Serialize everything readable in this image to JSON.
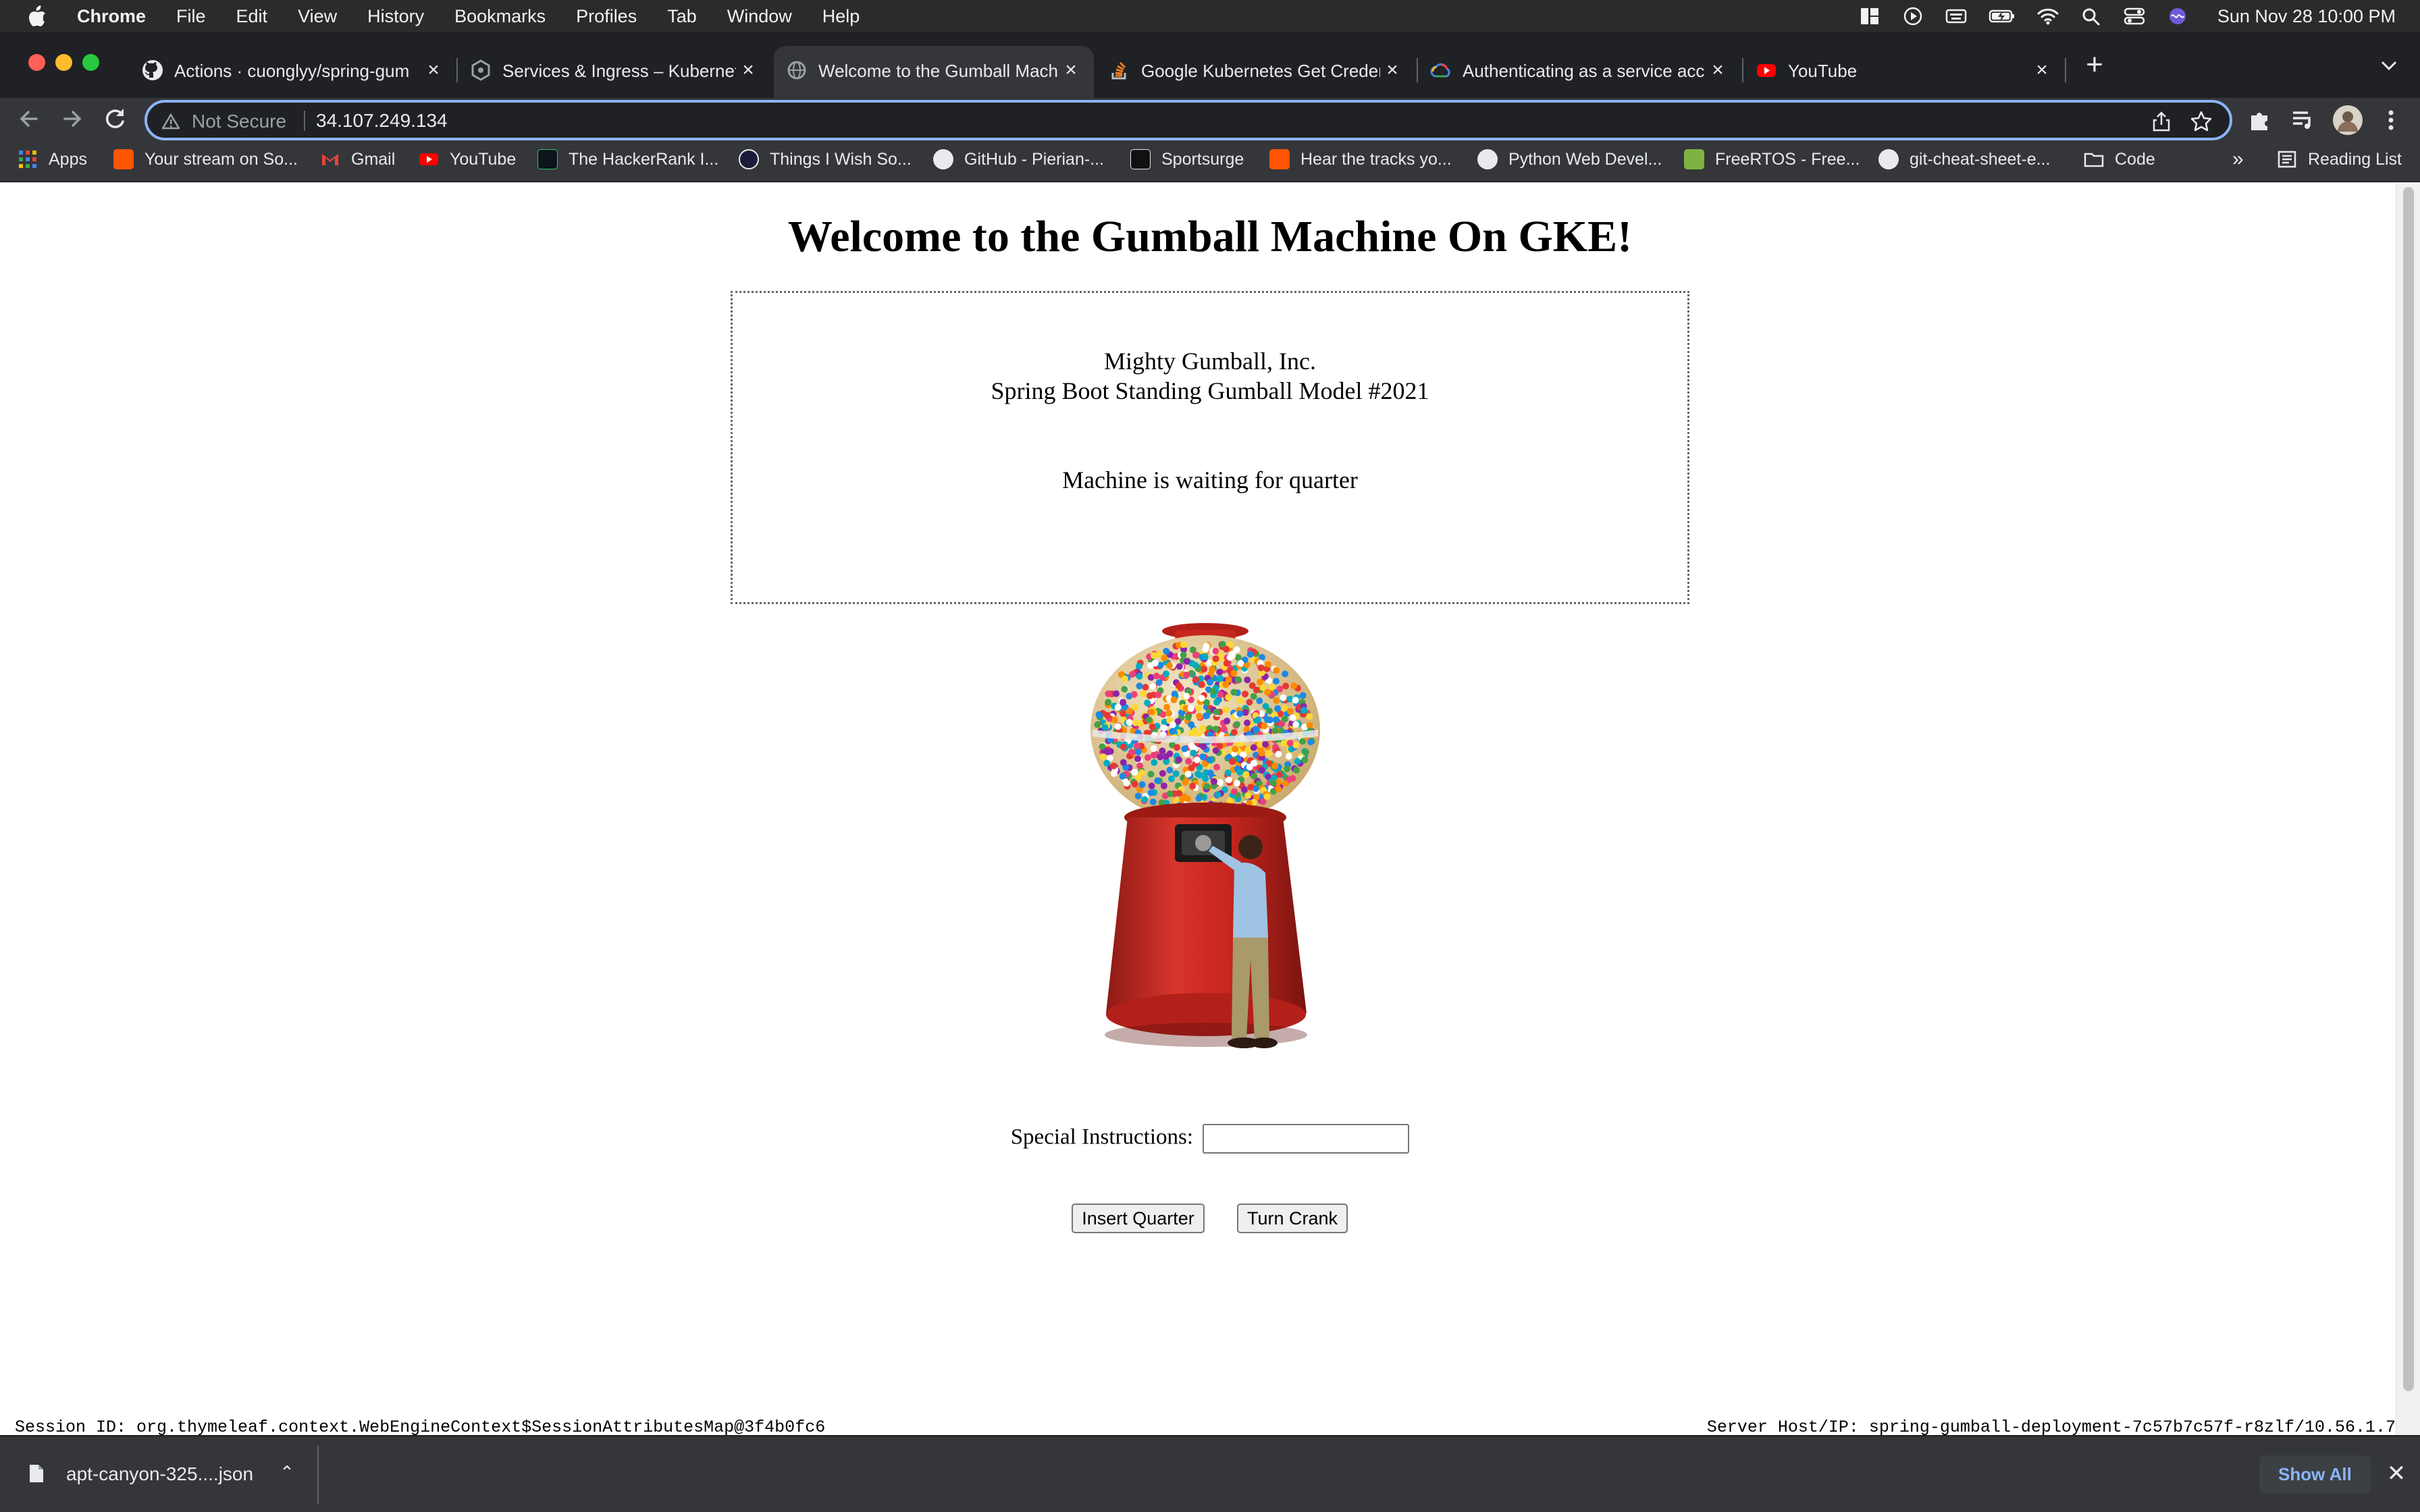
{
  "menubar": {
    "app": "Chrome",
    "items": [
      "File",
      "Edit",
      "View",
      "History",
      "Bookmarks",
      "Profiles",
      "Tab",
      "Window",
      "Help"
    ],
    "clock": "Sun Nov 28  10:00 PM"
  },
  "tabs": [
    {
      "title": "Actions · cuonglyy/spring-gum",
      "icon": "github-icon"
    },
    {
      "title": "Services & Ingress – Kubernete",
      "icon": "gke-icon"
    },
    {
      "title": "Welcome to the Gumball Machi",
      "icon": "globe-icon",
      "active": true
    },
    {
      "title": "Google Kubernetes Get Creden",
      "icon": "stackoverflow-icon"
    },
    {
      "title": "Authenticating as a service acc",
      "icon": "google-cloud-icon"
    },
    {
      "title": "YouTube",
      "icon": "youtube-icon"
    }
  ],
  "omnibox": {
    "security": "Not Secure",
    "url": "34.107.249.134"
  },
  "bookmarks": {
    "items": [
      "Apps",
      "Your stream on So...",
      "Gmail",
      "YouTube",
      "The HackerRank I...",
      "Things I Wish So...",
      "GitHub - Pierian-...",
      "Sportsurge",
      "Hear the tracks yo...",
      "Python Web Devel...",
      "FreeRTOS - Free...",
      "git-cheat-sheet-e...",
      "Code"
    ],
    "overflow": "»",
    "reading_list": "Reading List"
  },
  "page": {
    "heading": "Welcome to the Gumball Machine On GKE!",
    "company": "Mighty Gumball, Inc.",
    "model": "Spring Boot Standing Gumball Model #2021",
    "status": "Machine is waiting for quarter",
    "instructions_label": "Special Instructions:",
    "instructions_value": "",
    "insert_quarter": "Insert Quarter",
    "turn_crank": "Turn Crank",
    "session_id": "Session ID:  org.thymeleaf.context.WebEngineContext$SessionAttributesMap@3f4b0fc6",
    "server_host": "Server Host/IP:  spring-gumball-deployment-7c57b7c57f-r8zlf/10.56.1.7"
  },
  "downloads": {
    "file": "apt-canyon-325....json",
    "show_all": "Show All"
  },
  "colors": {
    "menubar": "#2b2b2d",
    "tabstrip": "#202124",
    "toolbar": "#35363a",
    "omnibox_focus": "#8ab4f8",
    "gumball_red": "#c8261e"
  }
}
